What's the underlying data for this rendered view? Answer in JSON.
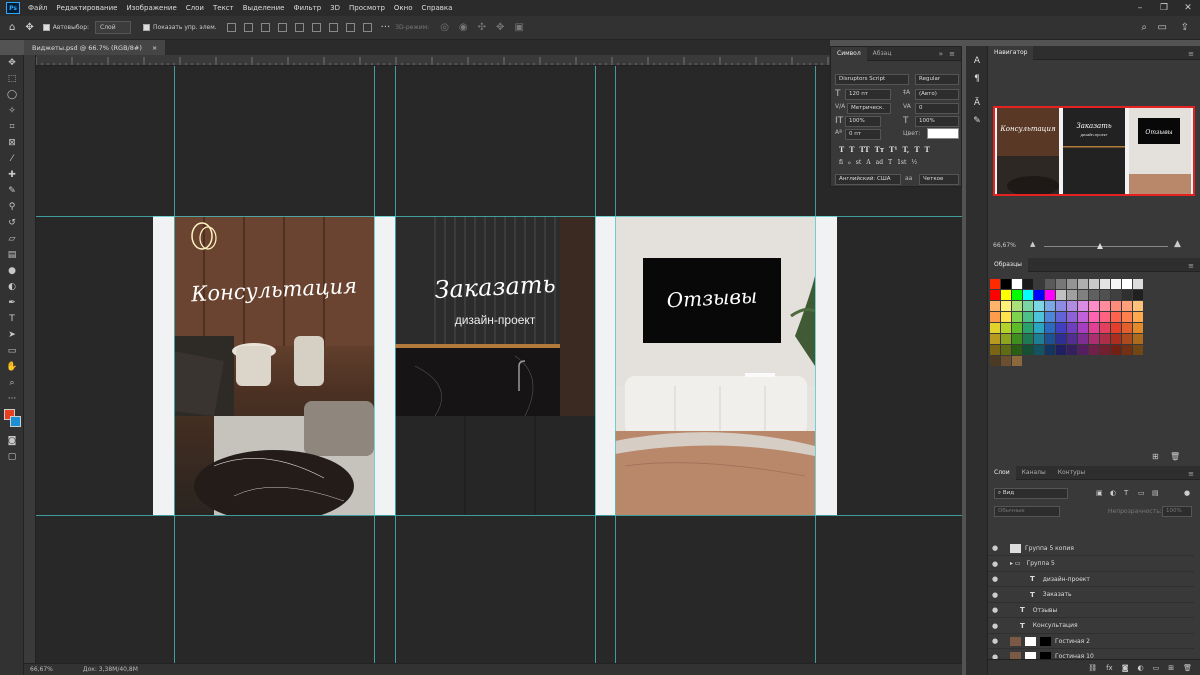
{
  "menubar": {
    "logo": "Ps",
    "items": [
      "Файл",
      "Редактирование",
      "Изображение",
      "Слои",
      "Текст",
      "Выделение",
      "Фильтр",
      "3D",
      "Просмотр",
      "Окно",
      "Справка"
    ]
  },
  "options": {
    "autoselect_label": "Автовыбор:",
    "autoselect_value": "Слой",
    "show_controls_label": "Показать упр. элем.",
    "mode_3d": "3D-режим:"
  },
  "document": {
    "tab_title": "Виджеты.psd @ 66.7% (RGB/8#)",
    "close": "×",
    "zoom": "66,67%",
    "doc_size": "Док: 3,38M/40,8M"
  },
  "widgets": [
    {
      "title": "Консультация",
      "subtitle": ""
    },
    {
      "title": "Заказать",
      "subtitle": "дизайн-проект"
    },
    {
      "title": "Отзывы",
      "subtitle": ""
    }
  ],
  "char_panel": {
    "tabs": [
      "Символ",
      "Абзац"
    ],
    "font_family": "Disruptors Script",
    "font_style": "Regular",
    "size": "120 пт",
    "leading": "(Авто)",
    "kerning": "Метрическ.",
    "tracking": "0",
    "vscale": "100%",
    "hscale": "100%",
    "baseline": "0 пт",
    "color_label": "Цвет:",
    "color": "#ffffff",
    "language": "Английский: США",
    "aa": "Четкое",
    "style_buttons_1": [
      "T",
      "T",
      "TT",
      "Tт",
      "T¹",
      "T,",
      "T",
      "T"
    ],
    "style_buttons_2": [
      "fi",
      "ℴ",
      "st",
      "A",
      "ad",
      "T",
      "1st",
      "½"
    ]
  },
  "navigator": {
    "title": "Навигатор",
    "zoom": "66,67%"
  },
  "swatches": {
    "title": "Образцы",
    "rows": [
      [
        "#ff2a00",
        "#000000",
        "#ffffff",
        "#1a1a1a",
        "#3a3a3a",
        "#5a5a5a",
        "#777777",
        "#949494",
        "#afafaf",
        "#c9c9c9",
        "#e3e3e3",
        "#f5f5f5",
        "#ffffff",
        "#dcdcdc"
      ],
      [
        "#ff0000",
        "#ffff00",
        "#00ff00",
        "#00ffff",
        "#0000ff",
        "#ff00ff",
        "#c0c0c0",
        "#a0a0a0",
        "#808080",
        "#606060",
        "#505050",
        "#404040",
        "#303030",
        "#202020"
      ],
      [
        "#ffb36b",
        "#fff07a",
        "#a9e07a",
        "#7ad4a4",
        "#7ad7e3",
        "#7aa8e3",
        "#8c8ce3",
        "#b08ce3",
        "#d88ce3",
        "#ff8cc8",
        "#ff8c9e",
        "#ff8c7a",
        "#ffa07a",
        "#ffc27a"
      ],
      [
        "#ff9b4d",
        "#ffe04d",
        "#7ed24d",
        "#4dc08a",
        "#4dc4d9",
        "#4d86d9",
        "#6262d9",
        "#8d62d9",
        "#c062d9",
        "#ff62b0",
        "#ff627e",
        "#ff624d",
        "#ff804d",
        "#ffa84d"
      ],
      [
        "#e3d22a",
        "#b5d22a",
        "#5dbb2a",
        "#2aa06d",
        "#2aa6c0",
        "#2a6ac0",
        "#3f3fc0",
        "#6d3fc0",
        "#a53fc0",
        "#e33f94",
        "#e33f5e",
        "#e33f2a",
        "#e3602a",
        "#e38b2a"
      ],
      [
        "#b89b1e",
        "#8ea41e",
        "#3f8f1e",
        "#1e7a52",
        "#1e7e93",
        "#1e5193",
        "#2e2e93",
        "#522e93",
        "#7e2e93",
        "#ad2e71",
        "#ad2e47",
        "#ad2e1e",
        "#ad4a1e",
        "#ad6b1e"
      ],
      [
        "#7a6514",
        "#5e6c14",
        "#2a5e14",
        "#145036",
        "#145361",
        "#143561",
        "#1f1f61",
        "#361f61",
        "#531f61",
        "#721f4a",
        "#721f2f",
        "#721f14",
        "#723114",
        "#724714"
      ],
      [
        "#4a3b22",
        "#6b4f2e",
        "#8a6a3c"
      ]
    ]
  },
  "layers": {
    "tabs": [
      "Слои",
      "Каналы",
      "Контуры"
    ],
    "filter": "Вид",
    "blend": "Обычные",
    "opacity_label": "Непрозрачность:",
    "opacity": "100%",
    "items": [
      {
        "name": "Группа 5 копия",
        "type": "group-copy",
        "indent": 0
      },
      {
        "name": "Группа 5",
        "type": "group",
        "indent": 0
      },
      {
        "name": "дизайн-проект",
        "type": "text",
        "indent": 2
      },
      {
        "name": "Заказать",
        "type": "text",
        "indent": 2
      },
      {
        "name": "Отзывы",
        "type": "text",
        "indent": 1
      },
      {
        "name": "Консультация",
        "type": "text",
        "indent": 1
      },
      {
        "name": "Гостиная 2",
        "type": "image",
        "indent": 0
      },
      {
        "name": "Гостиная 10",
        "type": "image",
        "indent": 0
      }
    ]
  }
}
